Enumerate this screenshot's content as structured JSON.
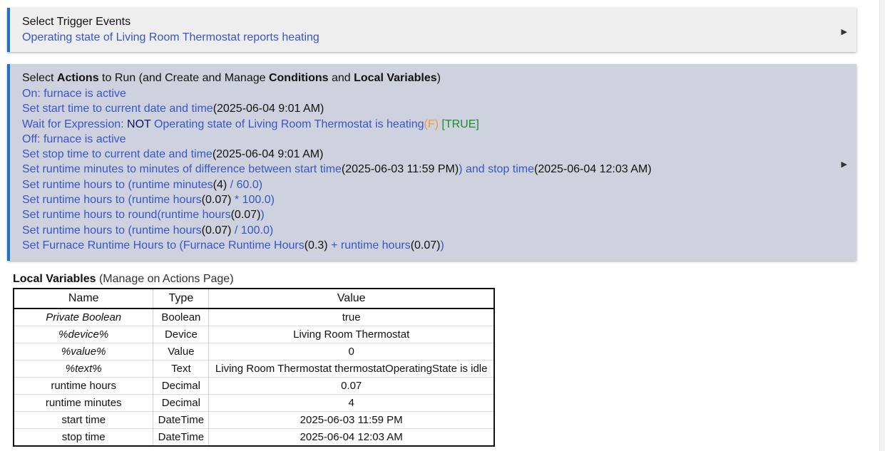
{
  "trigger": {
    "title": "Select Trigger Events",
    "event": "Operating state of Living Room Thermostat reports heating",
    "expand_icon": "triangle-right-icon"
  },
  "actions": {
    "title_parts": [
      "Select ",
      "Actions",
      " to Run (and Create and Manage ",
      "Conditions",
      " and ",
      "Local Variables",
      ")"
    ],
    "expand_icon": "triangle-right-icon",
    "lines": [
      [
        {
          "t": "On: furnace is active",
          "c": "link"
        }
      ],
      [
        {
          "t": "Set start time to current date and time",
          "c": "link"
        },
        {
          "t": "(2025-06-04 9:01 AM)",
          "c": "dark"
        }
      ],
      [
        {
          "t": "Wait for Expression: ",
          "c": "link"
        },
        {
          "t": "NOT",
          "c": "navy"
        },
        {
          "t": " Operating state of Living Room Thermostat is heating",
          "c": "link"
        },
        {
          "t": "(F)",
          "c": "orange"
        },
        {
          "t": " [TRUE]",
          "c": "green"
        }
      ],
      [
        {
          "t": "Off: furnace is active",
          "c": "link"
        }
      ],
      [
        {
          "t": "Set stop time to current date and time",
          "c": "link"
        },
        {
          "t": "(2025-06-04 9:01 AM)",
          "c": "dark"
        }
      ],
      [
        {
          "t": "Set runtime minutes to minutes of difference between start time",
          "c": "link"
        },
        {
          "t": "(2025-06-03 11:59 PM)",
          "c": "dark"
        },
        {
          "t": ") and stop time",
          "c": "link"
        },
        {
          "t": "(2025-06-04 12:03 AM)",
          "c": "dark"
        }
      ],
      [
        {
          "t": "Set runtime hours to (runtime minutes",
          "c": "link"
        },
        {
          "t": "(4)",
          "c": "dark"
        },
        {
          "t": " / 60.0)",
          "c": "link"
        }
      ],
      [
        {
          "t": "Set runtime hours to (runtime hours",
          "c": "link"
        },
        {
          "t": "(0.07)",
          "c": "dark"
        },
        {
          "t": " * 100.0)",
          "c": "link"
        }
      ],
      [
        {
          "t": "Set runtime hours to round(runtime hours",
          "c": "link"
        },
        {
          "t": "(0.07)",
          "c": "dark"
        },
        {
          "t": ")",
          "c": "link"
        }
      ],
      [
        {
          "t": "Set runtime hours to (runtime hours",
          "c": "link"
        },
        {
          "t": "(0.07)",
          "c": "dark"
        },
        {
          "t": " / 100.0)",
          "c": "link"
        }
      ],
      [
        {
          "t": "Set Furnace Runtime Hours to (Furnace Runtime Hours",
          "c": "link"
        },
        {
          "t": "(0.3)",
          "c": "dark"
        },
        {
          "t": " + runtime hours",
          "c": "link"
        },
        {
          "t": "(0.07)",
          "c": "dark"
        },
        {
          "t": ")",
          "c": "link"
        }
      ]
    ]
  },
  "local_variables": {
    "heading": "Local Variables",
    "subheading": "(Manage on Actions Page)",
    "columns": [
      "Name",
      "Type",
      "Value"
    ],
    "rows": [
      {
        "name": "Private Boolean",
        "type": "Boolean",
        "value": "true",
        "italic": true
      },
      {
        "name": "%device%",
        "type": "Device",
        "value": "Living Room Thermostat",
        "italic": true
      },
      {
        "name": "%value%",
        "type": "Value",
        "value": "0",
        "italic": true
      },
      {
        "name": "%text%",
        "type": "Text",
        "value": "Living Room Thermostat thermostatOperatingState is idle",
        "italic": true
      },
      {
        "name": "runtime hours",
        "type": "Decimal",
        "value": "0.07",
        "italic": false
      },
      {
        "name": "runtime minutes",
        "type": "Decimal",
        "value": "4",
        "italic": false
      },
      {
        "name": "start time",
        "type": "DateTime",
        "value": "2025-06-03 11:59 PM",
        "italic": false
      },
      {
        "name": "stop time",
        "type": "DateTime",
        "value": "2025-06-04 12:03 AM",
        "italic": false
      }
    ]
  }
}
